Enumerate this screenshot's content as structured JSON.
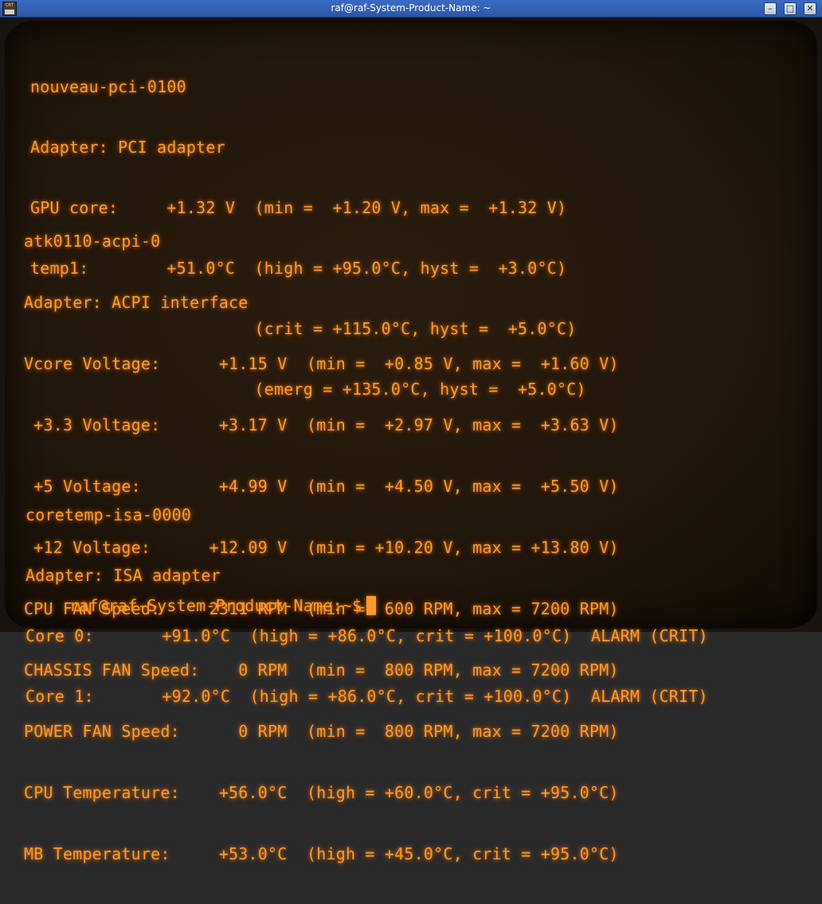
{
  "window": {
    "title": "raf@raf-System-Product-Name: ~",
    "app_icon_text": "CRT",
    "minimize_label": "–",
    "maximize_label": "□",
    "close_label": "✕"
  },
  "terminal": {
    "nouveau": [
      "nouveau-pci-0100",
      "Adapter: PCI adapter",
      "GPU core:     +1.32 V  (min =  +1.20 V, max =  +1.32 V)",
      "temp1:        +51.0°C  (high = +95.0°C, hyst =  +3.0°C)",
      "                       (crit = +115.0°C, hyst =  +5.0°C)",
      "                       (emerg = +135.0°C, hyst =  +5.0°C)"
    ],
    "atk": [
      "atk0110-acpi-0",
      "Adapter: ACPI interface",
      "Vcore Voltage:      +1.15 V  (min =  +0.85 V, max =  +1.60 V)",
      " +3.3 Voltage:      +3.17 V  (min =  +2.97 V, max =  +3.63 V)",
      " +5 Voltage:        +4.99 V  (min =  +4.50 V, max =  +5.50 V)",
      " +12 Voltage:      +12.09 V  (min = +10.20 V, max = +13.80 V)",
      "CPU FAN Speed:     2311 RPM  (min =  600 RPM, max = 7200 RPM)",
      "CHASSIS FAN Speed:    0 RPM  (min =  800 RPM, max = 7200 RPM)",
      "POWER FAN Speed:      0 RPM  (min =  800 RPM, max = 7200 RPM)",
      "CPU Temperature:    +56.0°C  (high = +60.0°C, crit = +95.0°C)",
      "MB Temperature:     +53.0°C  (high = +45.0°C, crit = +95.0°C)"
    ],
    "coretemp": [
      "coretemp-isa-0000",
      "Adapter: ISA adapter",
      "Core 0:       +91.0°C  (high = +86.0°C, crit = +100.0°C)  ALARM (CRIT)",
      "Core 1:       +92.0°C  (high = +86.0°C, crit = +100.0°C)  ALARM (CRIT)"
    ],
    "prompt": "raf@raf-System-Product-Name:~$"
  },
  "colors": {
    "phosphor": "#ff9a2a",
    "titlebar": "#2c57a8"
  }
}
